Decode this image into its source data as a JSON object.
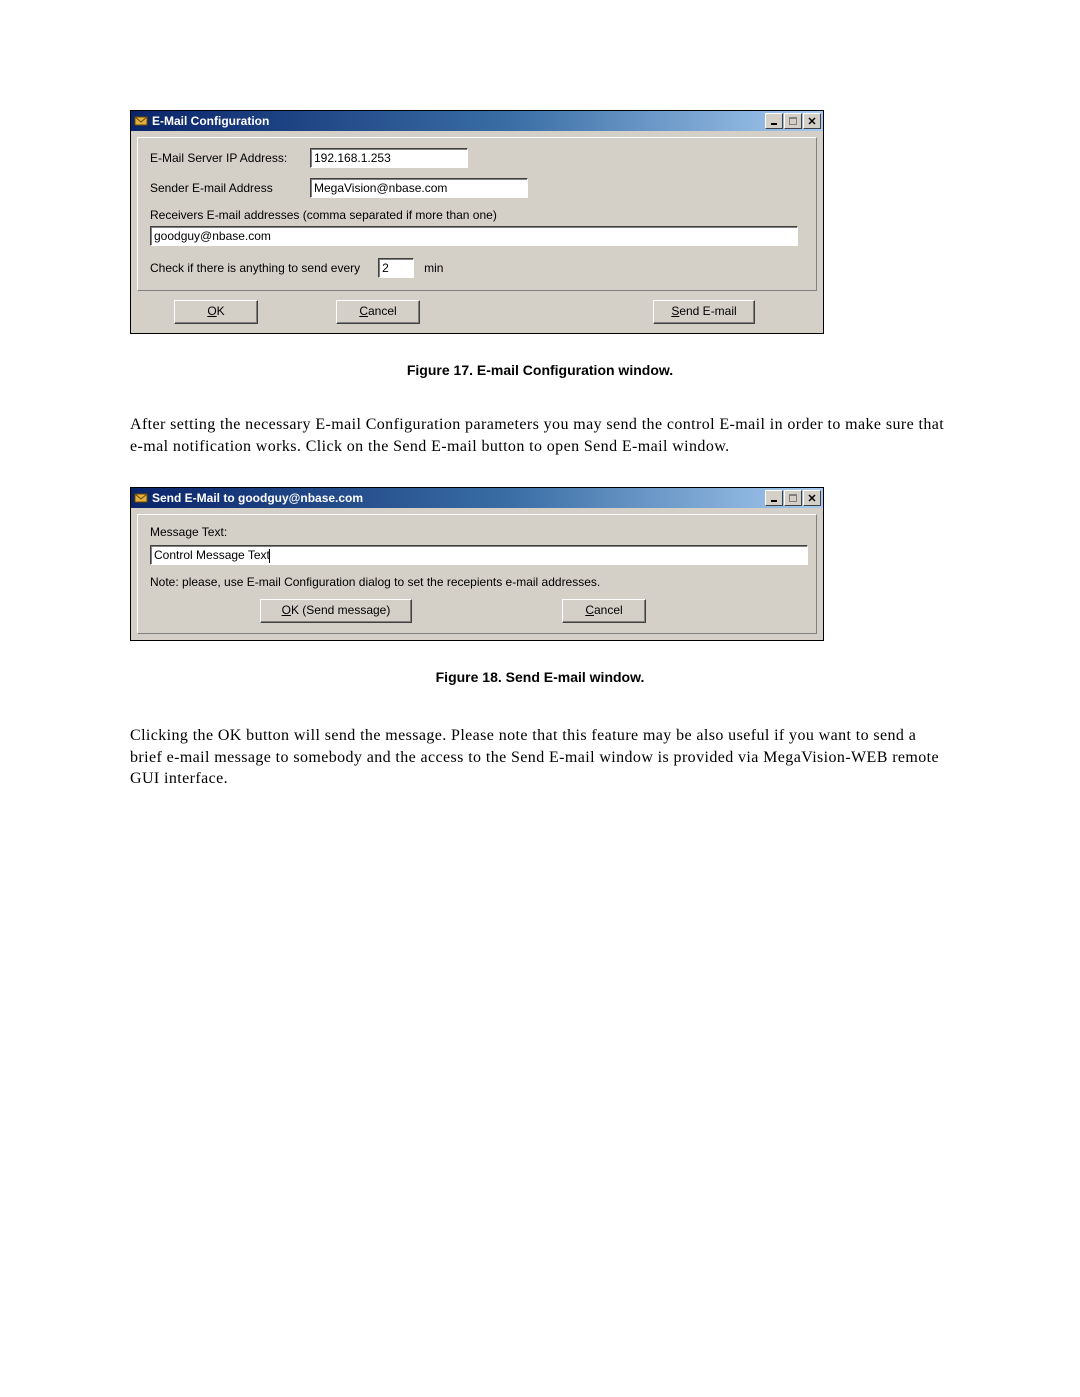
{
  "fig17": {
    "window_title": "E-Mail Configuration",
    "server_label": "E-Mail Server IP Address:",
    "server_value": "192.168.1.253",
    "sender_label": "Sender E-mail Address",
    "sender_value": "MegaVision@nbase.com",
    "receivers_label": "Receivers E-mail addresses (comma separated if more than one)",
    "receivers_value": "goodguy@nbase.com",
    "check_label_pre": "Check if there is anything to send every",
    "check_value": "2",
    "check_label_post": "min",
    "btn_ok": "OK",
    "btn_cancel": "Cancel",
    "btn_send": "Send E-mail",
    "caption": "Figure 17. E-mail Configuration window."
  },
  "para1": "After setting the necessary E-mail Configuration parameters you may send the control E-mail in order to make sure that e-mal notification works. Click on the Send E-mail button to open Send E-mail window.",
  "fig18": {
    "window_title": "Send E-Mail to goodguy@nbase.com",
    "msg_label": "Message Text:",
    "msg_value": "Control Message Text",
    "note": "Note: please, use E-mail Configuration dialog to set the recepients e-mail addresses.",
    "btn_ok": "OK (Send message)",
    "btn_cancel": "Cancel",
    "caption": "Figure 18. Send E-mail window."
  },
  "para2": "Clicking the OK button will send the message. Please note that this feature may be also useful if you want to send a brief e-mail message to somebody and the access to the Send E-mail window is provided via MegaVision-WEB remote GUI interface."
}
